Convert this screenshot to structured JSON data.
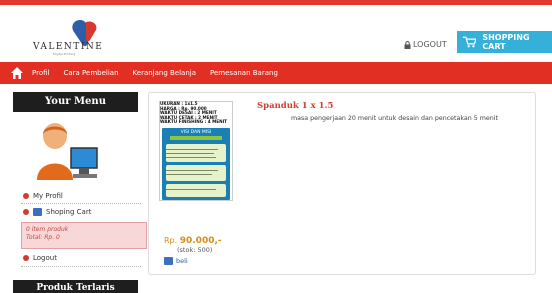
{
  "header": {
    "logo_text": "VALENTINE",
    "logo_sub": "Digital Printing",
    "logout_label": "LOGOUT",
    "cart_button_label": "SHOPPING CART"
  },
  "nav": {
    "items": [
      {
        "label": "Profil"
      },
      {
        "label": "Cara Pembelian"
      },
      {
        "label": "Keranjang Belanja"
      },
      {
        "label": "Pemesanan Barang"
      }
    ]
  },
  "sidebar": {
    "title": "Your Menu",
    "items": [
      {
        "label": "My Profil"
      },
      {
        "label": "Shoping Cart"
      },
      {
        "label": "Logout"
      }
    ],
    "cart_summary": {
      "items": "0 item produk",
      "total": "Total: Rp. 0"
    },
    "second_title": "Produk Terlaris"
  },
  "product": {
    "title": "Spanduk 1 x 1.5",
    "description": "masa pengerjaan 20 menit untuk desain dan pencetakan 5 menit",
    "image_specs": [
      "UKURAN          : 1x1.5",
      "HARGA           : Rp. 90.000",
      "WAKTU DESAI  : 2 MENIT",
      "WAKTU CETAK  : 2 MENIT",
      "WAKTU FINISHING : 4 MENIT"
    ],
    "image_banner_title": "VISI DAN MISI",
    "price_prefix": "Rp. ",
    "price_value": "90.000,-",
    "stock": "(stok: 500)",
    "buy_label": "beli"
  },
  "colors": {
    "accent_red": "#e12f23",
    "cart_blue": "#35b0d8",
    "price_orange": "#d8891a"
  }
}
